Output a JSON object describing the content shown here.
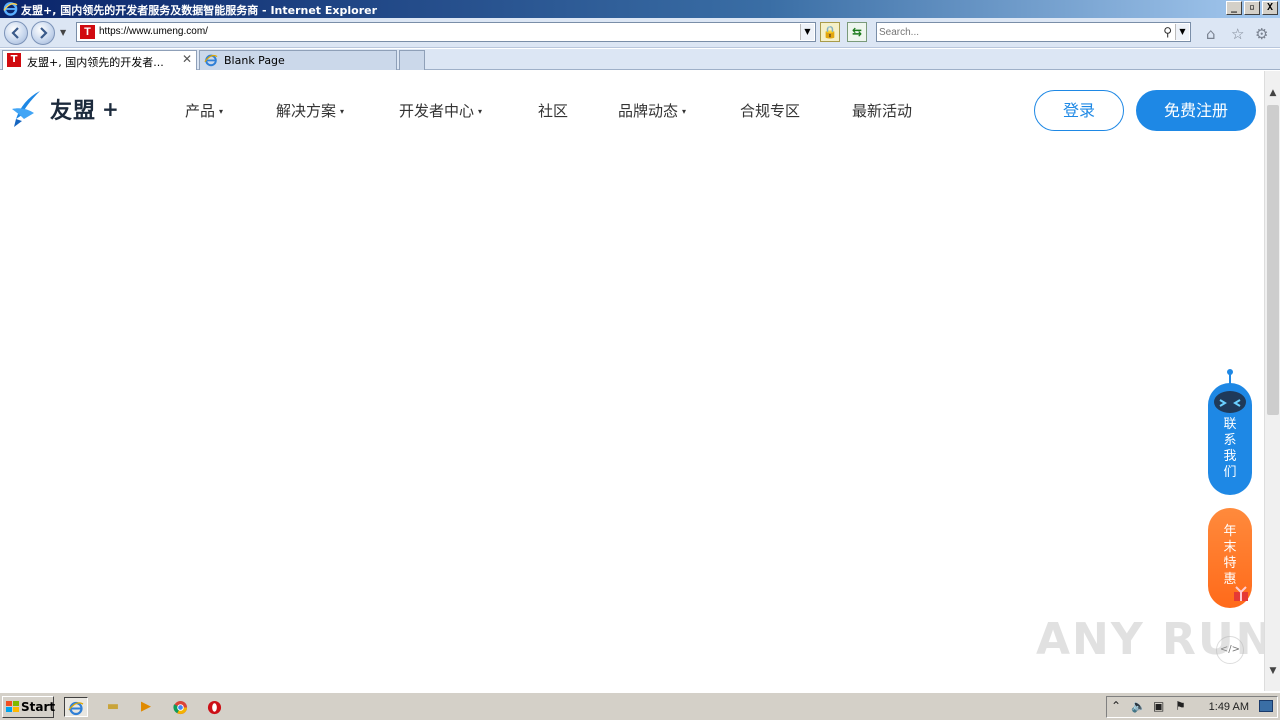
{
  "window": {
    "title": "友盟+, 国内领先的开发者服务及数据智能服务商 - Internet Explorer",
    "controls": [
      "_",
      "▫",
      "X"
    ]
  },
  "addressbar": {
    "url": "https://www.umeng.com/",
    "search_placeholder": "Search..."
  },
  "tabs": [
    {
      "label": "友盟+, 国内领先的开发者...",
      "close": "✕",
      "active": true
    },
    {
      "label": "Blank Page",
      "active": false
    }
  ],
  "site": {
    "logo_text": "友盟",
    "logo_plus": "+",
    "nav": [
      {
        "label": "产品",
        "has_caret": true,
        "caret": "▾"
      },
      {
        "label": "解决方案",
        "has_caret": true,
        "caret": "▾"
      },
      {
        "label": "开发者中心",
        "has_caret": true,
        "caret": "▾"
      },
      {
        "label": "社区",
        "has_caret": false
      },
      {
        "label": "品牌动态",
        "has_caret": true,
        "caret": "▾"
      },
      {
        "label": "合规专区",
        "has_caret": false
      },
      {
        "label": "最新活动",
        "has_caret": false
      }
    ],
    "login_label": "登录",
    "register_label": "免费注册",
    "contact_label": "联\n系\n我\n们",
    "promo_label": "年\n末\n特\n惠",
    "accent_color": "#1e88e5",
    "promo_color": "#ff6a1a"
  },
  "watermark": "ANY RUN",
  "taskbar": {
    "start_label": "Start",
    "clock": "1:49 AM"
  }
}
